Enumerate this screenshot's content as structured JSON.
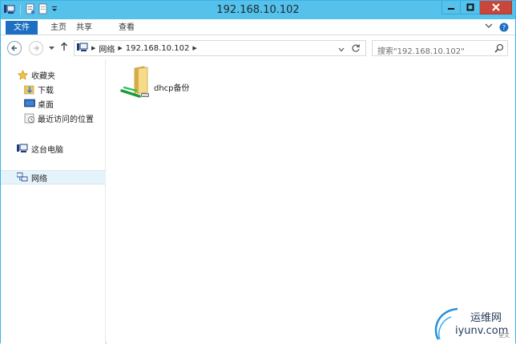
{
  "window": {
    "title": "192.168.10.102"
  },
  "ribbon": {
    "tabs": [
      {
        "label": "文件"
      },
      {
        "label": "主页"
      },
      {
        "label": "共享"
      },
      {
        "label": "查看"
      }
    ]
  },
  "address": {
    "crumbs": [
      "网络",
      "192.168.10.102"
    ]
  },
  "search": {
    "placeholder": "搜索\"192.168.10.102\""
  },
  "navpane": {
    "favorites": {
      "label": "收藏夹"
    },
    "downloads": {
      "label": "下载"
    },
    "desktop": {
      "label": "桌面"
    },
    "recent": {
      "label": "最近访问的位置"
    },
    "thispc": {
      "label": "这台电脑"
    },
    "network": {
      "label": "网络"
    }
  },
  "content": {
    "items": [
      {
        "name": "dhcp备份",
        "icon": "network-share-folder-icon"
      }
    ]
  },
  "watermark": {
    "line1": "运维网",
    "line2": "iyunv.com",
    "line3": "全文"
  },
  "colors": {
    "titlebar": "#56c1ea",
    "file_tab": "#1c6fc2",
    "close_button": "#c9473a",
    "selection": "#e5f3fb"
  }
}
